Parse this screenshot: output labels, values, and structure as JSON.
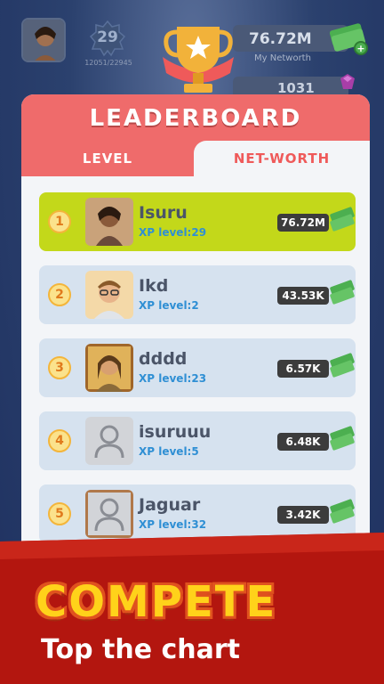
{
  "hud": {
    "level": "29",
    "xp_progress": "12051/22945",
    "networth_value": "76.72M",
    "networth_label": "My Networth",
    "gems_value": "1031"
  },
  "panel": {
    "title": "LEADERBOARD",
    "tabs": [
      {
        "label": "LEVEL",
        "active": false
      },
      {
        "label": "NET-WORTH",
        "active": true
      }
    ]
  },
  "rows": [
    {
      "rank": "1",
      "name": "Isuru",
      "xp": "XP level:29",
      "money": "76.72M"
    },
    {
      "rank": "2",
      "name": "Ikd",
      "xp": "XP level:2",
      "money": "43.53K"
    },
    {
      "rank": "3",
      "name": "dddd",
      "xp": "XP level:23",
      "money": "6.57K"
    },
    {
      "rank": "4",
      "name": "isuruuu",
      "xp": "XP level:5",
      "money": "6.48K"
    },
    {
      "rank": "5",
      "name": "Jaguar",
      "xp": "XP level:32",
      "money": "3.42K"
    }
  ],
  "banner": {
    "headline": "COMPETE",
    "tagline": "Top the chart"
  },
  "colors": {
    "header": "#ef6b6b",
    "first_row": "#c3d81a",
    "row": "#d6e2ef",
    "banner": "#b3160f",
    "headline": "#ffd21a"
  }
}
